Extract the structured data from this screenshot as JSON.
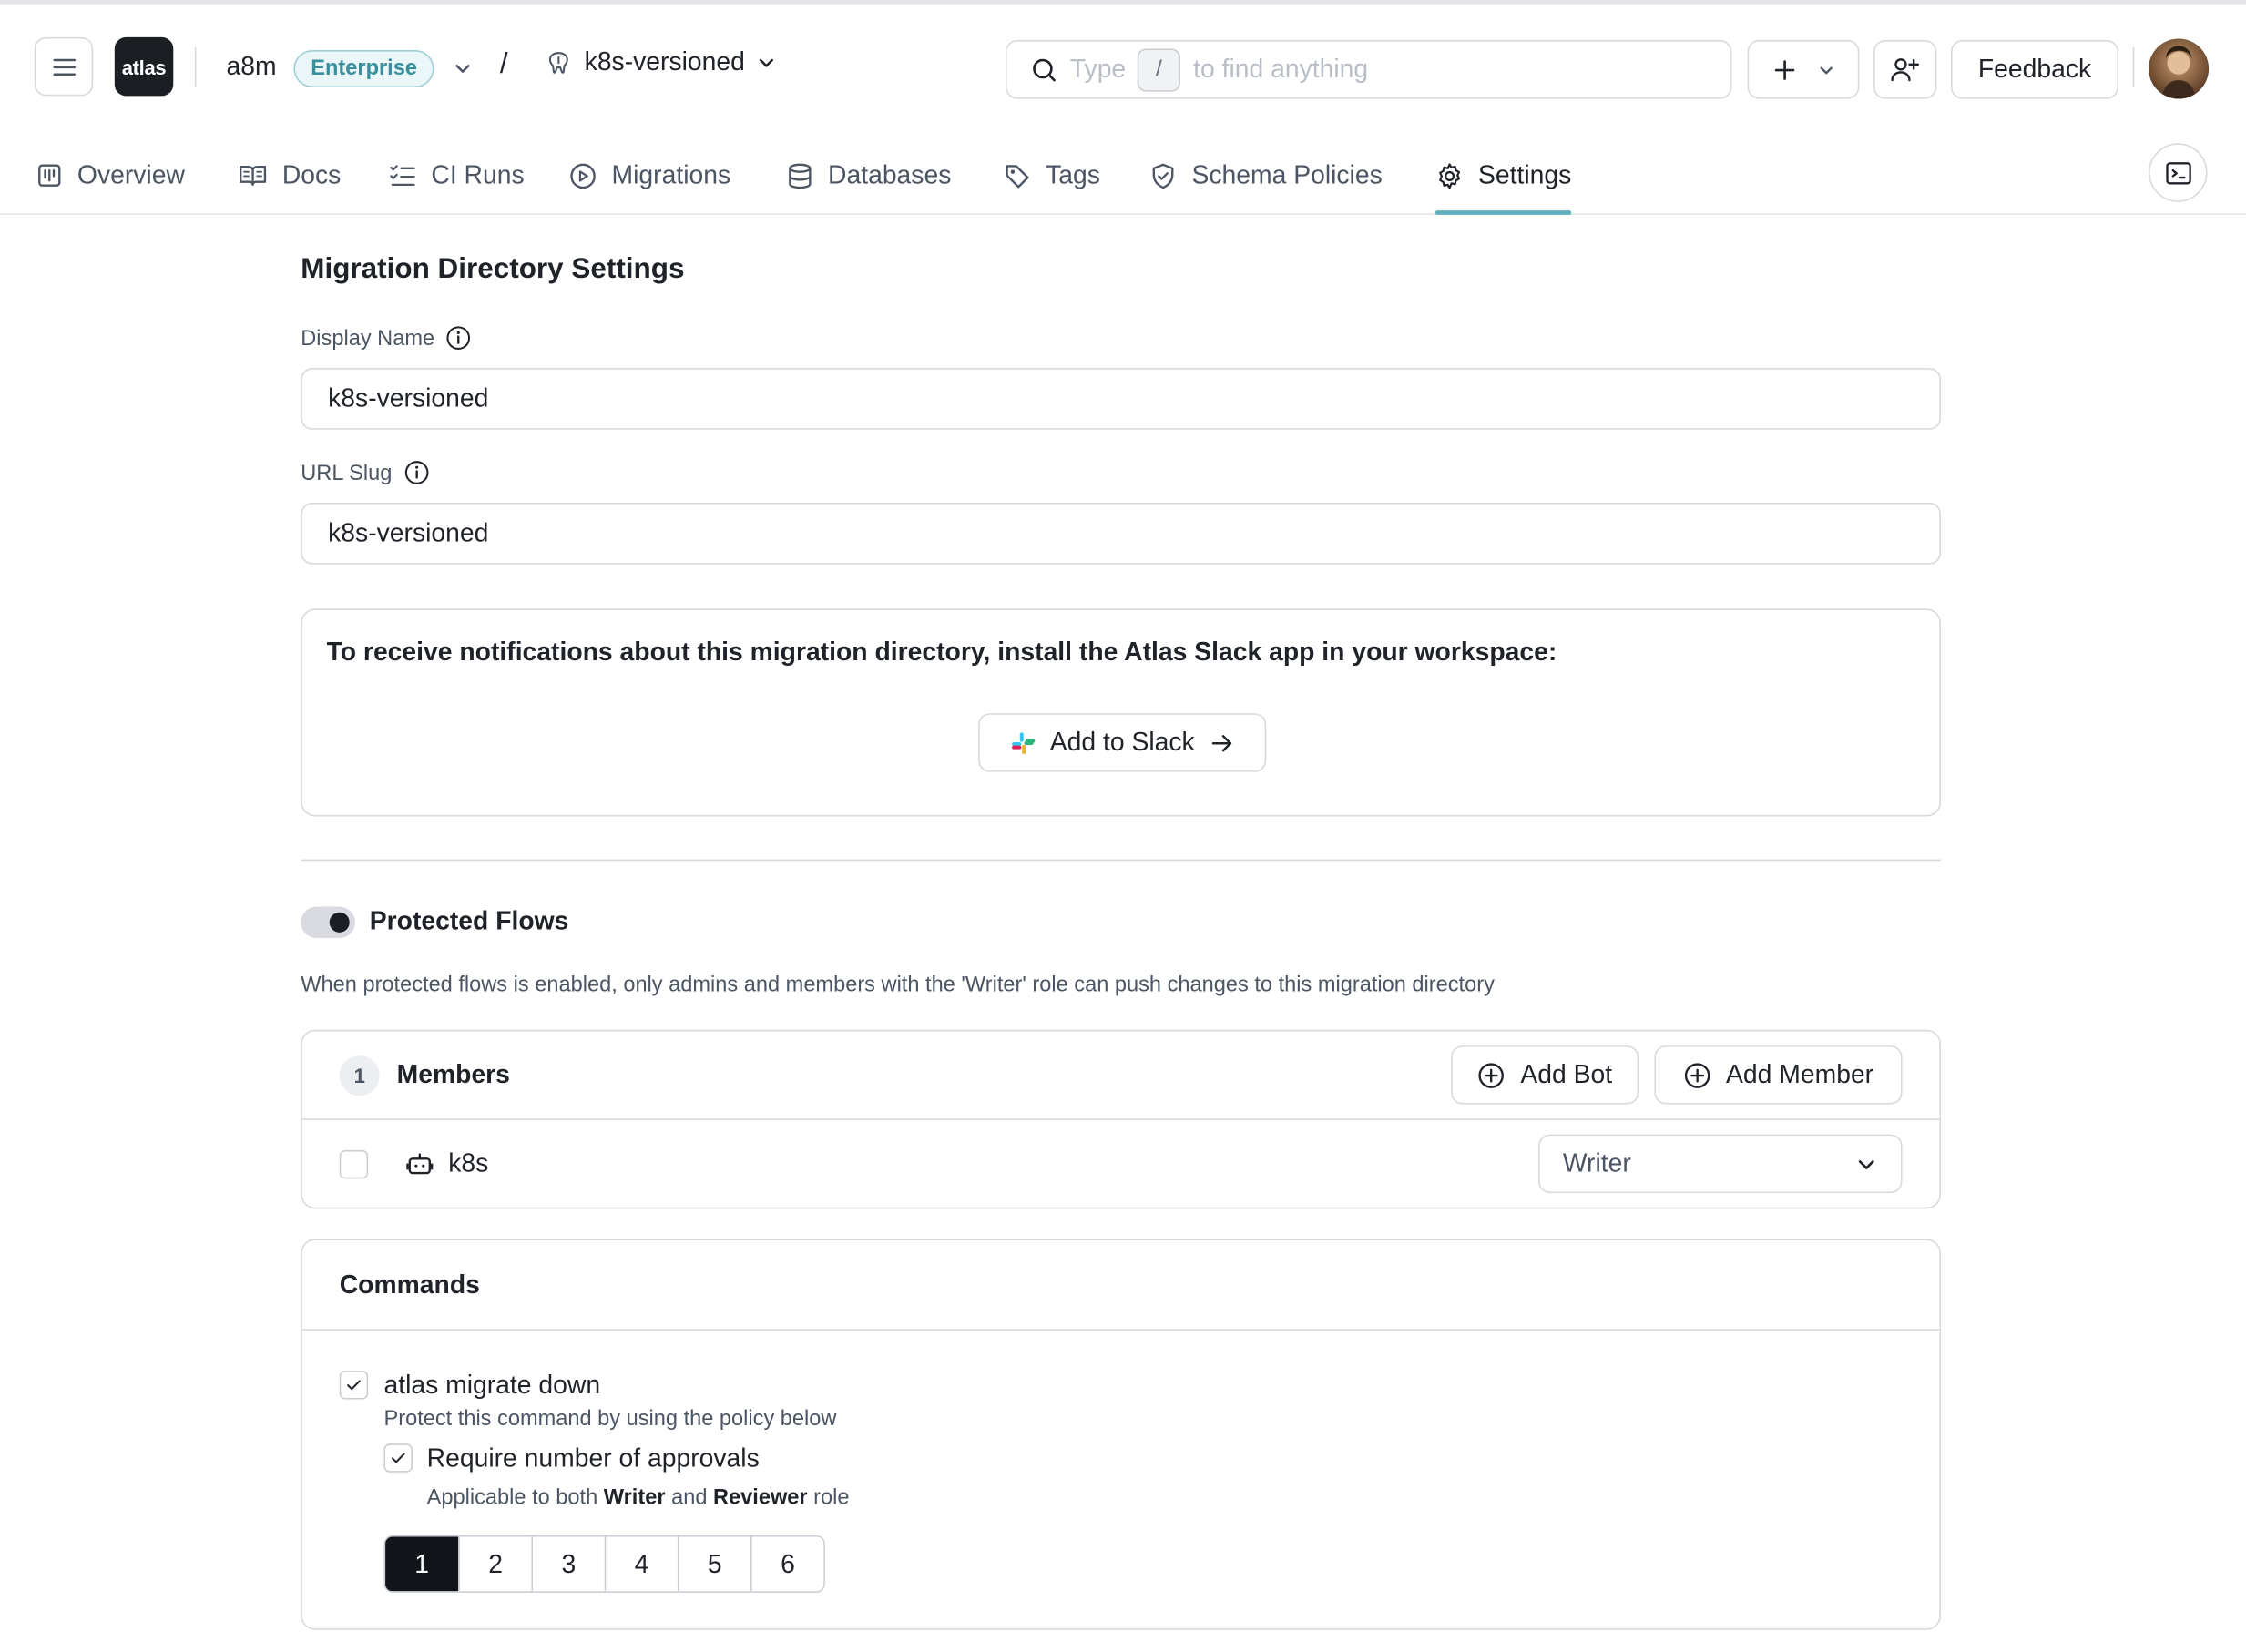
{
  "header": {
    "logo_text": "atlas",
    "org_name": "a8m",
    "plan_badge": "Enterprise",
    "separator": "/",
    "project_name": "k8s-versioned",
    "search": {
      "prefix": "Type",
      "shortcut": "/",
      "suffix": "to find anything"
    },
    "feedback_label": "Feedback"
  },
  "tabs": [
    {
      "label": "Overview",
      "icon": "overview-icon"
    },
    {
      "label": "Docs",
      "icon": "book-icon"
    },
    {
      "label": "CI Runs",
      "icon": "list-check-icon"
    },
    {
      "label": "Migrations",
      "icon": "play-circle-icon"
    },
    {
      "label": "Databases",
      "icon": "database-icon"
    },
    {
      "label": "Tags",
      "icon": "tag-icon"
    },
    {
      "label": "Schema Policies",
      "icon": "shield-check-icon"
    },
    {
      "label": "Settings",
      "icon": "gear-icon",
      "active": true
    }
  ],
  "settings": {
    "title": "Migration Directory Settings",
    "display_name": {
      "label": "Display Name",
      "value": "k8s-versioned"
    },
    "url_slug": {
      "label": "URL Slug",
      "value": "k8s-versioned"
    },
    "slack": {
      "message": "To receive notifications about this migration directory, install the Atlas Slack app in your workspace:",
      "button_label": "Add to Slack"
    },
    "protected_flows": {
      "title": "Protected Flows",
      "enabled": true,
      "description": "When protected flows is enabled, only admins and members with the 'Writer' role can push changes to this migration directory"
    },
    "members": {
      "count": "1",
      "title": "Members",
      "add_bot_label": "Add Bot",
      "add_member_label": "Add Member",
      "rows": [
        {
          "name": "k8s",
          "type": "bot",
          "role": "Writer"
        }
      ]
    },
    "commands": {
      "title": "Commands",
      "command": "atlas migrate down",
      "command_desc": "Protect this command by using the policy below",
      "require_label": "Require number of approvals",
      "require_desc_pre": "Applicable to both ",
      "require_desc_role1": "Writer",
      "require_desc_mid": " and ",
      "require_desc_role2": "Reviewer",
      "require_desc_post": " role",
      "approval_options": [
        "1",
        "2",
        "3",
        "4",
        "5",
        "6"
      ],
      "approvals_selected": "1"
    }
  },
  "colors": {
    "accent": "#5fb0bd",
    "badge_bg": "#eaf6f8",
    "dark": "#111418"
  }
}
